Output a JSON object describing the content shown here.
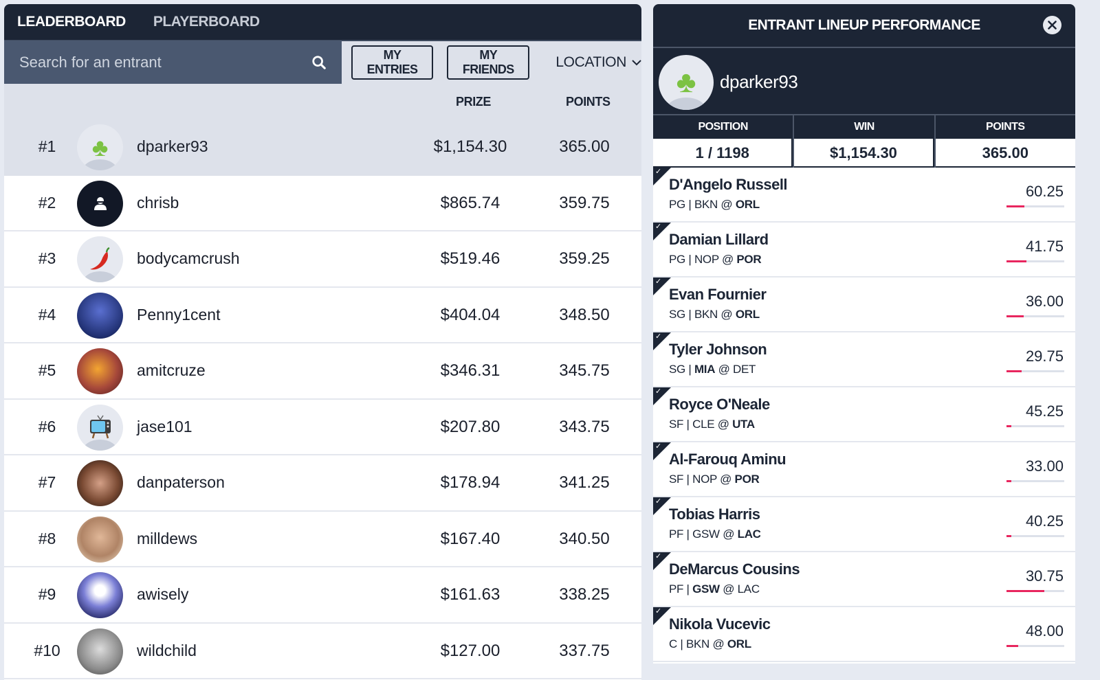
{
  "left": {
    "tabs": [
      {
        "label": "LEADERBOARD",
        "active": true
      },
      {
        "label": "PLAYERBOARD",
        "active": false
      }
    ],
    "search": {
      "placeholder": "Search for an entrant",
      "value": ""
    },
    "filters": {
      "my_entries": "MY ENTRIES",
      "my_friends": "MY FRIENDS",
      "location": "LOCATION"
    },
    "columns": {
      "prize": "PRIZE",
      "points": "POINTS"
    },
    "rows": [
      {
        "rank": "#1",
        "name": "dparker93",
        "prize": "$1,154.30",
        "points": "365.00",
        "avatar": "clover",
        "highlight": true
      },
      {
        "rank": "#2",
        "name": "chrisb",
        "prize": "$865.74",
        "points": "359.75",
        "avatar": "default-user"
      },
      {
        "rank": "#3",
        "name": "bodycamcrush",
        "prize": "$519.46",
        "points": "359.25",
        "avatar": "chili-pepper"
      },
      {
        "rank": "#4",
        "name": "Penny1cent",
        "prize": "$404.04",
        "points": "348.50",
        "avatar": "photo-basketball"
      },
      {
        "rank": "#5",
        "name": "amitcruze",
        "prize": "$346.31",
        "points": "345.75",
        "avatar": "photo-fire"
      },
      {
        "rank": "#6",
        "name": "jase101",
        "prize": "$207.80",
        "points": "343.75",
        "avatar": "television"
      },
      {
        "rank": "#7",
        "name": "danpaterson",
        "prize": "$178.94",
        "points": "341.25",
        "avatar": "photo-person"
      },
      {
        "rank": "#8",
        "name": "milldews",
        "prize": "$167.40",
        "points": "340.50",
        "avatar": "photo-person"
      },
      {
        "rank": "#9",
        "name": "awisely",
        "prize": "$161.63",
        "points": "338.25",
        "avatar": "cartoon-character"
      },
      {
        "rank": "#10",
        "name": "wildchild",
        "prize": "$127.00",
        "points": "337.75",
        "avatar": "tin-can"
      }
    ]
  },
  "right": {
    "title": "ENTRANT LINEUP PERFORMANCE",
    "user": {
      "name": "dparker93",
      "avatar": "clover"
    },
    "stats": [
      {
        "label": "POSITION",
        "value": "1 / 1198"
      },
      {
        "label": "WIN",
        "value": "$1,154.30"
      },
      {
        "label": "POINTS",
        "value": "365.00"
      }
    ],
    "players": [
      {
        "name": "D'Angelo Russell",
        "pos": "PG",
        "away": "BKN",
        "home": "ORL",
        "bold_team": "home",
        "score": "60.25",
        "progress": 0.31
      },
      {
        "name": "Damian Lillard",
        "pos": "PG",
        "away": "NOP",
        "home": "POR",
        "bold_team": "home",
        "score": "41.75",
        "progress": 0.35
      },
      {
        "name": "Evan Fournier",
        "pos": "SG",
        "away": "BKN",
        "home": "ORL",
        "bold_team": "home",
        "score": "36.00",
        "progress": 0.3
      },
      {
        "name": "Tyler Johnson",
        "pos": "SG",
        "away": "MIA",
        "home": "DET",
        "bold_team": "away",
        "score": "29.75",
        "progress": 0.26
      },
      {
        "name": "Royce O'Neale",
        "pos": "SF",
        "away": "CLE",
        "home": "UTA",
        "bold_team": "home",
        "score": "45.25",
        "progress": 0.08
      },
      {
        "name": "Al-Farouq Aminu",
        "pos": "SF",
        "away": "NOP",
        "home": "POR",
        "bold_team": "home",
        "score": "33.00",
        "progress": 0.08
      },
      {
        "name": "Tobias Harris",
        "pos": "PF",
        "away": "GSW",
        "home": "LAC",
        "bold_team": "home",
        "score": "40.25",
        "progress": 0.08
      },
      {
        "name": "DeMarcus Cousins",
        "pos": "PF",
        "away": "GSW",
        "home": "LAC",
        "bold_team": "away",
        "score": "30.75",
        "progress": 0.66
      },
      {
        "name": "Nikola Vucevic",
        "pos": "C",
        "away": "BKN",
        "home": "ORL",
        "bold_team": "home",
        "score": "48.00",
        "progress": 0.2
      }
    ]
  },
  "colors": {
    "navy": "#1c2535",
    "slate": "#4a5870",
    "highlight_row": "#dde1ea",
    "progress": "#e8265e"
  }
}
